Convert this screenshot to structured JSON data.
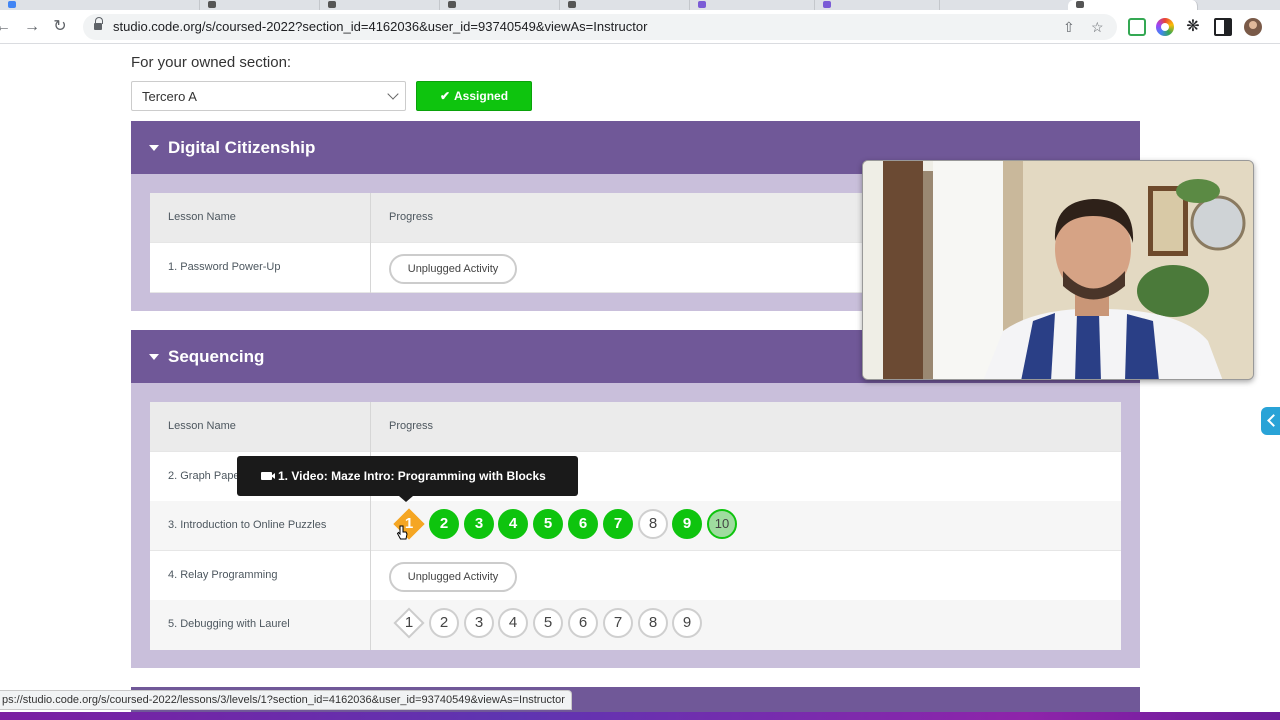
{
  "browser": {
    "url": "studio.code.org/s/coursed-2022?section_id=4162036&user_id=93740549&viewAs=Instructor",
    "status_url": "ps://studio.code.org/s/coursed-2022/lessons/3/levels/1?section_id=4162036&user_id=93740549&viewAs=Instructor"
  },
  "section_picker": {
    "label": "For your owned section:",
    "selected": "Tercero A",
    "assigned_label": "Assigned"
  },
  "units": [
    {
      "title": "Digital Citizenship",
      "header_lesson": "Lesson Name",
      "header_progress": "Progress",
      "lessons": [
        {
          "name": "1. Password Power-Up",
          "progress_label": "Unplugged Activity"
        }
      ]
    },
    {
      "title": "Sequencing",
      "header_lesson": "Lesson Name",
      "header_progress": "Progress",
      "lessons": [
        {
          "name": "2. Graph Paper"
        },
        {
          "name": "3. Introduction to Online Puzzles",
          "bubbles": [
            {
              "label": "1",
              "state": "in-progress-video"
            },
            {
              "label": "2",
              "state": "completed"
            },
            {
              "label": "3",
              "state": "completed"
            },
            {
              "label": "4",
              "state": "completed"
            },
            {
              "label": "5",
              "state": "completed"
            },
            {
              "label": "6",
              "state": "completed"
            },
            {
              "label": "7",
              "state": "completed"
            },
            {
              "label": "8",
              "state": "not-started"
            },
            {
              "label": "9",
              "state": "completed"
            },
            {
              "label": "10",
              "state": "assessment"
            }
          ]
        },
        {
          "name": "4. Relay Programming",
          "progress_label": "Unplugged Activity"
        },
        {
          "name": "5. Debugging with Laurel",
          "bubbles": [
            {
              "label": "1",
              "state": "not-started-video"
            },
            {
              "label": "2",
              "state": "not-started"
            },
            {
              "label": "3",
              "state": "not-started"
            },
            {
              "label": "4",
              "state": "not-started"
            },
            {
              "label": "5",
              "state": "not-started"
            },
            {
              "label": "6",
              "state": "not-started"
            },
            {
              "label": "7",
              "state": "not-started"
            },
            {
              "label": "8",
              "state": "not-started"
            },
            {
              "label": "9",
              "state": "not-started"
            }
          ]
        }
      ]
    }
  ],
  "tooltip": {
    "text": "1. Video: Maze Intro: Programming with Blocks"
  },
  "colors": {
    "unit_header": "#705898",
    "unit_body": "#c9bfdb",
    "completed": "#0ec40e",
    "in_progress": "#f5a623"
  }
}
